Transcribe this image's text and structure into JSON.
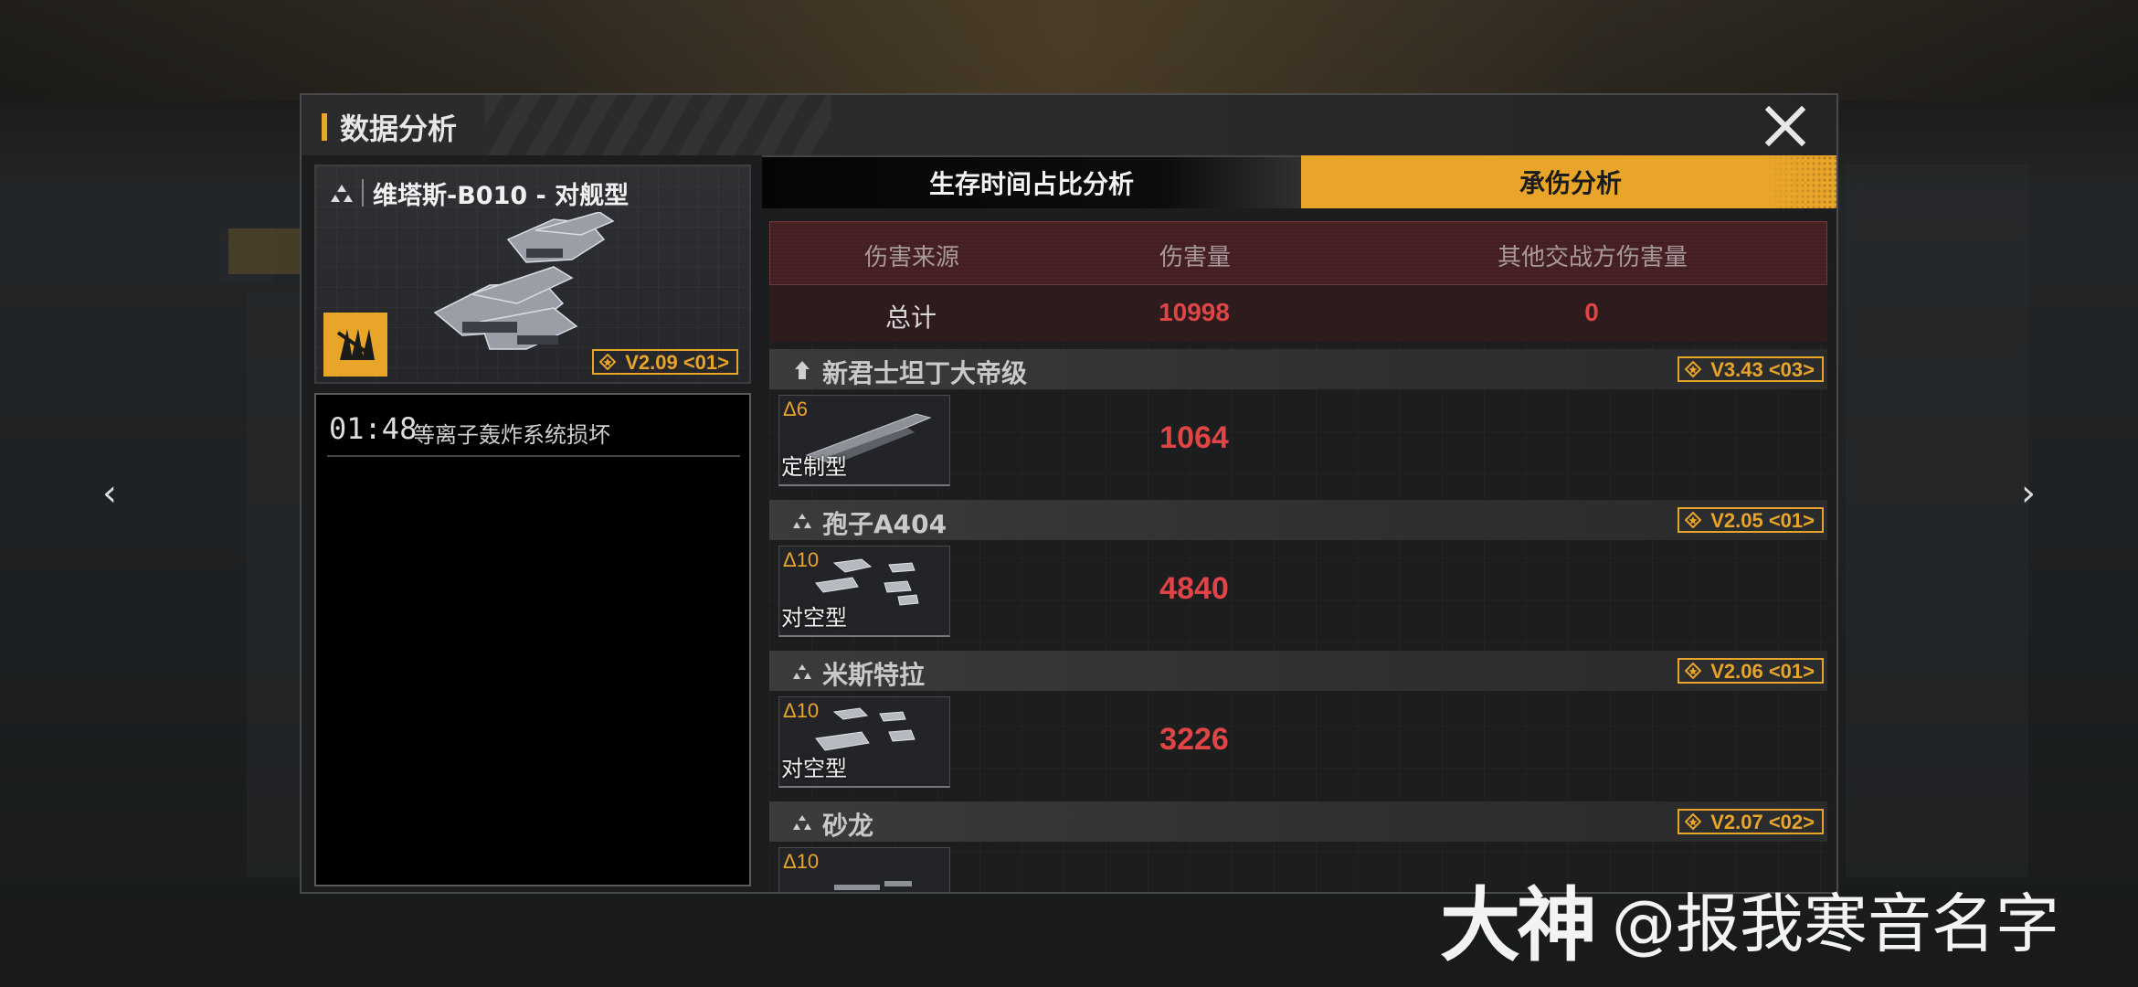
{
  "dialog": {
    "title": "数据分析",
    "close_label": "×"
  },
  "ship": {
    "name": "维塔斯-B010 - 对舰型",
    "version": "V2.09 <01>",
    "icon": "ship-class-icon"
  },
  "log": [
    {
      "time": "01:48",
      "text": "等离子轰炸系统损坏"
    }
  ],
  "tabs": [
    {
      "label": "生存时间占比分析",
      "active": false
    },
    {
      "label": "承伤分析",
      "active": true
    }
  ],
  "table": {
    "headers": [
      "伤害来源",
      "伤害量",
      "其他交战方伤害量"
    ],
    "total": {
      "label": "总计",
      "damage": "10998",
      "other_damage": "0"
    }
  },
  "sources": [
    {
      "name": "新君士坦丁大帝级",
      "version": "V3.43 <03>",
      "rank": "Δ6",
      "type": "定制型",
      "damage": "1064"
    },
    {
      "name": "孢子A404",
      "version": "V2.05 <01>",
      "rank": "Δ10",
      "type": "对空型",
      "damage": "4840"
    },
    {
      "name": "米斯特拉",
      "version": "V2.06 <01>",
      "rank": "Δ10",
      "type": "对空型",
      "damage": "3226"
    },
    {
      "name": "砂龙",
      "version": "V2.07 <02>",
      "rank": "Δ10",
      "type": "",
      "damage": ""
    }
  ],
  "watermark": {
    "logo": "大神",
    "handle": "@报我寒音名字"
  },
  "colors": {
    "accent": "#e8a52a",
    "damage": "#e04545",
    "header_bg": "#4a2225"
  }
}
